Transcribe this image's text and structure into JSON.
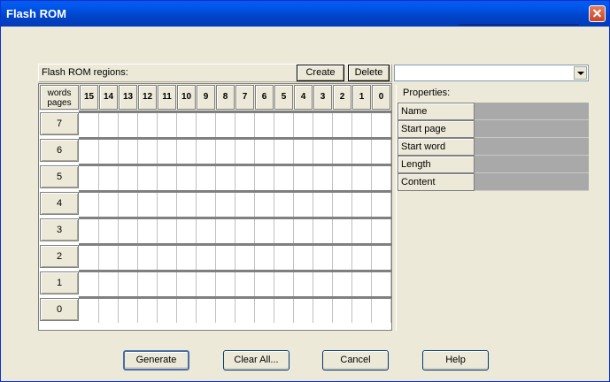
{
  "window": {
    "title": "Flash ROM"
  },
  "regions": {
    "label": "Flash ROM regions:",
    "create_label": "Create",
    "delete_label": "Delete",
    "dropdown_value": ""
  },
  "grid": {
    "corner_top": "words",
    "corner_bottom": "pages",
    "columns": [
      "15",
      "14",
      "13",
      "12",
      "11",
      "10",
      "9",
      "8",
      "7",
      "6",
      "5",
      "4",
      "3",
      "2",
      "1",
      "0"
    ],
    "rows": [
      "7",
      "6",
      "5",
      "4",
      "3",
      "2",
      "1",
      "0"
    ]
  },
  "properties": {
    "title": "Properties:",
    "items": [
      {
        "label": "Name",
        "value": ""
      },
      {
        "label": "Start page",
        "value": ""
      },
      {
        "label": "Start word",
        "value": ""
      },
      {
        "label": "Length",
        "value": ""
      },
      {
        "label": "Content",
        "value": ""
      }
    ]
  },
  "buttons": {
    "generate": "Generate",
    "clear_all": "Clear All...",
    "cancel": "Cancel",
    "help": "Help"
  },
  "colors": {
    "titlebar": "#0054e3",
    "dialog_bg": "#ece9d8",
    "property_value_bg": "#aaa9a9",
    "close_button": "#e06a4a"
  }
}
